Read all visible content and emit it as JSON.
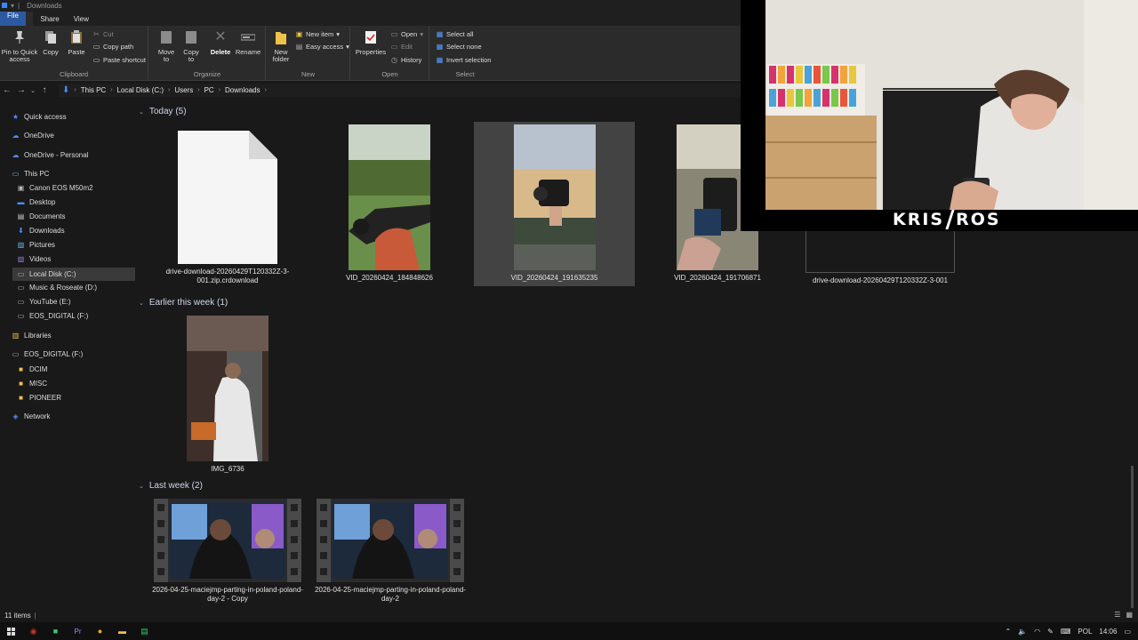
{
  "window": {
    "title": "Downloads"
  },
  "ribbon": {
    "tabs": [
      "File",
      "Home",
      "Share",
      "View"
    ],
    "clipboard": {
      "pin": "Pin to Quick access",
      "copy": "Copy",
      "paste": "Paste",
      "cut": "Cut",
      "copy_path": "Copy path",
      "paste_shortcut": "Paste shortcut",
      "label": "Clipboard"
    },
    "organize": {
      "move_to": "Move to",
      "copy_to": "Copy to",
      "delete": "Delete",
      "rename": "Rename",
      "label": "Organize"
    },
    "new": {
      "new_folder": "New folder",
      "new_item": "New item",
      "easy_access": "Easy access",
      "label": "New"
    },
    "open": {
      "properties": "Properties",
      "open": "Open",
      "edit": "Edit",
      "history": "History",
      "label": "Open"
    },
    "select": {
      "select_all": "Select all",
      "select_none": "Select none",
      "invert": "Invert selection",
      "label": "Select"
    }
  },
  "address": {
    "crumbs": [
      "This PC",
      "Local Disk (C:)",
      "Users",
      "PC",
      "Downloads"
    ]
  },
  "nav": {
    "quick_access": "Quick access",
    "onedrive": "OneDrive",
    "onedrive_personal": "OneDrive - Personal",
    "this_pc": "This PC",
    "items": [
      "Canon EOS M50m2",
      "Desktop",
      "Documents",
      "Downloads",
      "Pictures",
      "Videos",
      "Local Disk (C:)",
      "Music & Roseate (D:)",
      "YouTube (E:)",
      "EOS_DIGITAL (F:)"
    ],
    "libraries": "Libraries",
    "eos": "EOS_DIGITAL (F:)",
    "eos_children": [
      "DCIM",
      "MISC",
      "PIONEER"
    ],
    "network": "Network"
  },
  "sections": {
    "today": "Today (5)",
    "earlier": "Earlier this week (1)",
    "last_week": "Last week (2)"
  },
  "files": {
    "today": [
      {
        "name": "drive-download-20260429T120332Z-3-001.zip.crdownload"
      },
      {
        "name": "VID_20260424_184848626"
      },
      {
        "name": "VID_20260424_191635235"
      },
      {
        "name": "VID_20260424_191706871"
      },
      {
        "name": "drive-download-20260429T120332Z-3-001"
      }
    ],
    "earlier": [
      {
        "name": "IMG_6736"
      }
    ],
    "last_week": [
      {
        "name": "2026-04-25-maciejmp-parting-in-poland-poland-day-2 - Copy"
      },
      {
        "name": "2026-04-25-maciejmp-parting-in-poland-poland-day-2"
      }
    ]
  },
  "status": {
    "count": "11 items"
  },
  "taskbar": {
    "lang": "POL",
    "time": "14:06"
  },
  "overlay": {
    "brand_left": "KRIS",
    "brand_right": "ROS"
  },
  "colors": {
    "accent": "#2c5aa0",
    "folder": "#f1c24b",
    "background": "#191919"
  }
}
